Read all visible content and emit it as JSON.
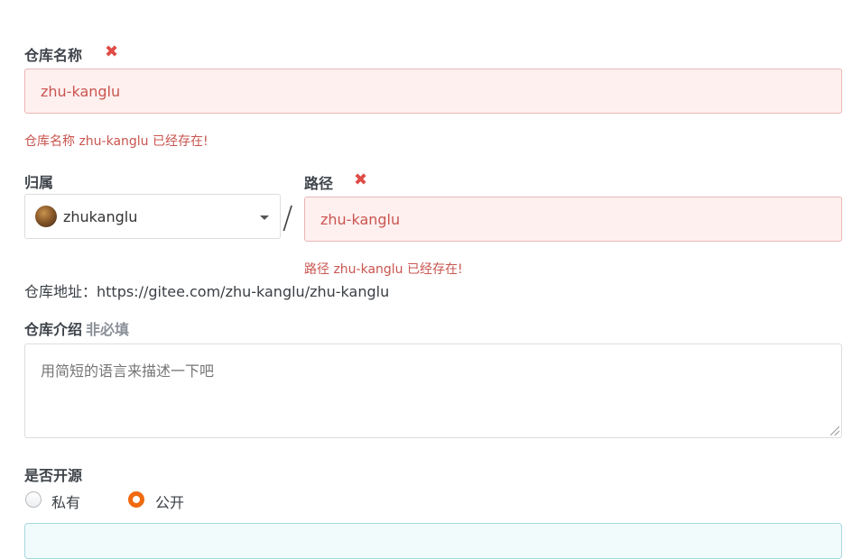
{
  "repo_name": {
    "label": "仓库名称",
    "value": "zhu-kanglu",
    "error": "仓库名称 zhu-kanglu 已经存在!"
  },
  "owner": {
    "label": "归属",
    "selected": "zhukanglu",
    "separator": "/"
  },
  "path": {
    "label": "路径",
    "value": "zhu-kanglu",
    "error": "路径 zhu-kanglu 已经存在!"
  },
  "repo_url": {
    "text": "仓库地址：https://gitee.com/zhu-kanglu/zhu-kanglu"
  },
  "description": {
    "label": "仓库介绍",
    "optional_tag": "非必填",
    "placeholder": "用简短的语言来描述一下吧"
  },
  "visibility": {
    "label": "是否开源",
    "options": [
      {
        "label": "私有",
        "checked": false
      },
      {
        "label": "公开",
        "checked": true
      }
    ]
  },
  "colors": {
    "error": "#e04b46",
    "radio_accent": "#f06a0f"
  }
}
